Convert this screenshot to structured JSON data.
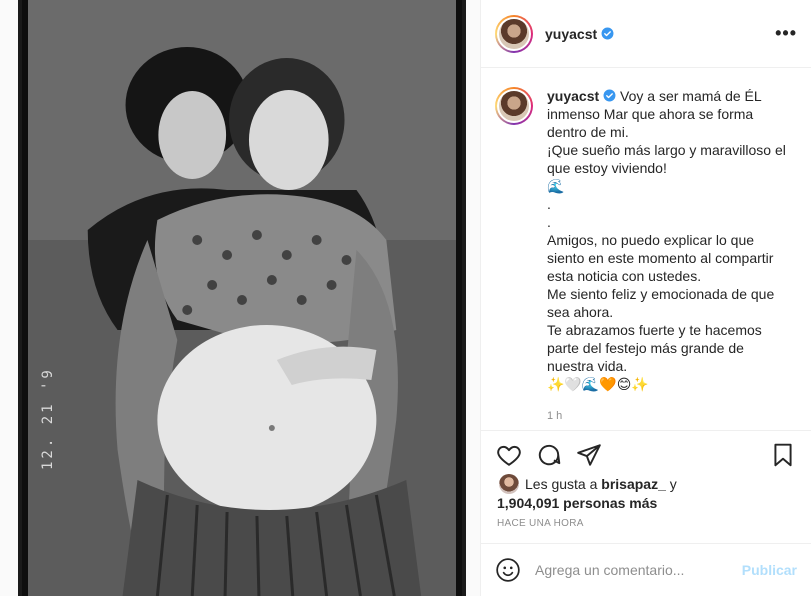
{
  "post": {
    "username": "yuyacst",
    "verified": true,
    "more_label": "•••",
    "film_date": "12. 21 '9"
  },
  "caption": {
    "username": "yuyacst",
    "lines": [
      "Voy a ser mamá de ÉL",
      "inmenso Mar que ahora se forma",
      "dentro de mi.",
      "¡Que sueño más largo y maravilloso el",
      "que estoy viviendo!",
      "🌊",
      ".",
      ".",
      "Amigos, no puedo explicar lo que",
      "siento en este momento al compartir",
      "esta noticia con ustedes.",
      "Me siento feliz y emocionada de que",
      "sea ahora.",
      "Te abrazamos fuerte y te hacemos",
      "parte del festejo más grande de",
      "nuestra vida.",
      "✨🤍🌊🧡😊✨"
    ],
    "time_ago": "1 h"
  },
  "actions": {
    "like_icon": "heart-icon",
    "comment_icon": "comment-icon",
    "share_icon": "share-icon",
    "save_icon": "bookmark-icon"
  },
  "likes": {
    "prefix": "Les gusta a",
    "first_user": "brisapaz_",
    "conjunction": "y",
    "count_text": "1,904,091 personas más"
  },
  "posted_label": "HACE UNA HORA",
  "comment": {
    "placeholder": "Agrega un comentario...",
    "publish_label": "Publicar"
  },
  "colors": {
    "verified": "#3897f0",
    "publish_disabled": "#b2dffc",
    "secondary_text": "#8e8e8e",
    "border": "#efefef"
  }
}
